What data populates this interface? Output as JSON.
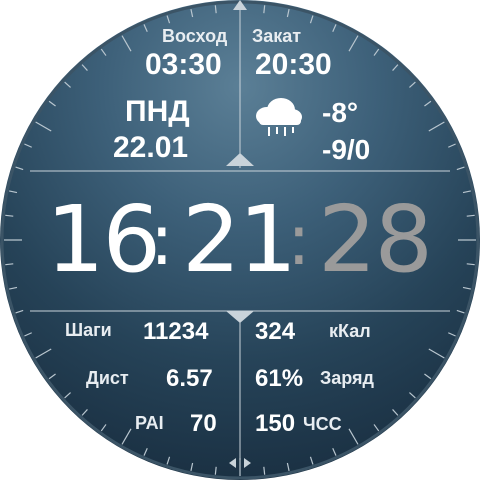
{
  "sun": {
    "sunrise_label": "Восход",
    "sunrise_time": "03:30",
    "sunset_label": "Закат",
    "sunset_time": "20:30"
  },
  "date": {
    "weekday": "ПНД",
    "day_month": "22.01"
  },
  "weather": {
    "icon": "cloud-rain-icon",
    "temp_current": "-8°",
    "temp_range": "-9/0"
  },
  "time": {
    "hours": "16",
    "minutes": "21",
    "seconds": "28",
    "sep": ":"
  },
  "stats": {
    "steps_label": "Шаги",
    "steps_value": "11234",
    "calories_value": "324",
    "calories_label": "кКал",
    "distance_label": "Дист",
    "distance_value": "6.57",
    "battery_value": "61%",
    "battery_label": "Заряд",
    "pai_label": "PAI",
    "pai_value": "70",
    "heart_value": "150",
    "heart_label": "ЧСС"
  },
  "colors": {
    "background": "#264358",
    "text": "#ffffff",
    "seconds": "#9a9a9a",
    "divider": "#c9d3da"
  }
}
